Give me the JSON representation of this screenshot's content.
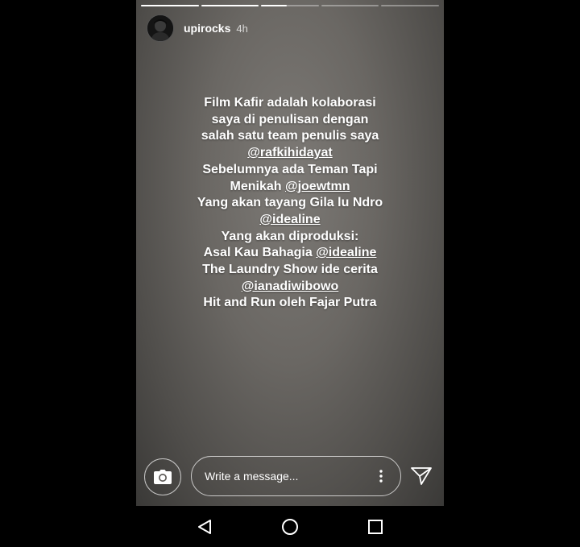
{
  "story": {
    "segments": [
      {
        "progress": 1.0
      },
      {
        "progress": 1.0
      },
      {
        "progress": 0.45
      },
      {
        "progress": 0.0
      },
      {
        "progress": 0.0
      }
    ],
    "username": "upirocks",
    "time_ago": "4h",
    "lines": [
      [
        {
          "text": "Film Kafir adalah kolaborasi"
        }
      ],
      [
        {
          "text": "saya di penulisan dengan"
        }
      ],
      [
        {
          "text": "salah satu team penulis saya"
        }
      ],
      [
        {
          "text": "@rafkihidayat",
          "mention": true
        }
      ],
      [
        {
          "text": "Sebelumnya ada Teman Tapi"
        }
      ],
      [
        {
          "text": "Menikah "
        },
        {
          "text": "@joewtmn",
          "mention": true
        }
      ],
      [
        {
          "text": "Yang akan tayang Gila lu Ndro"
        }
      ],
      [
        {
          "text": "@idealine",
          "mention": true
        }
      ],
      [
        {
          "text": "Yang akan diproduksi:"
        }
      ],
      [
        {
          "text": "Asal Kau Bahagia "
        },
        {
          "text": "@idealine",
          "mention": true
        }
      ],
      [
        {
          "text": "The Laundry Show ide cerita"
        }
      ],
      [
        {
          "text": "@ianadiwibowo",
          "mention": true
        }
      ],
      [
        {
          "text": "Hit and Run oleh Fajar Putra"
        }
      ]
    ]
  },
  "composer": {
    "placeholder": "Write a message...",
    "icons": {
      "camera": "camera-icon",
      "more": "more-vertical-icon",
      "send": "send-icon"
    }
  },
  "navbar": {
    "icons": [
      "back-icon",
      "home-icon",
      "recents-icon"
    ]
  }
}
